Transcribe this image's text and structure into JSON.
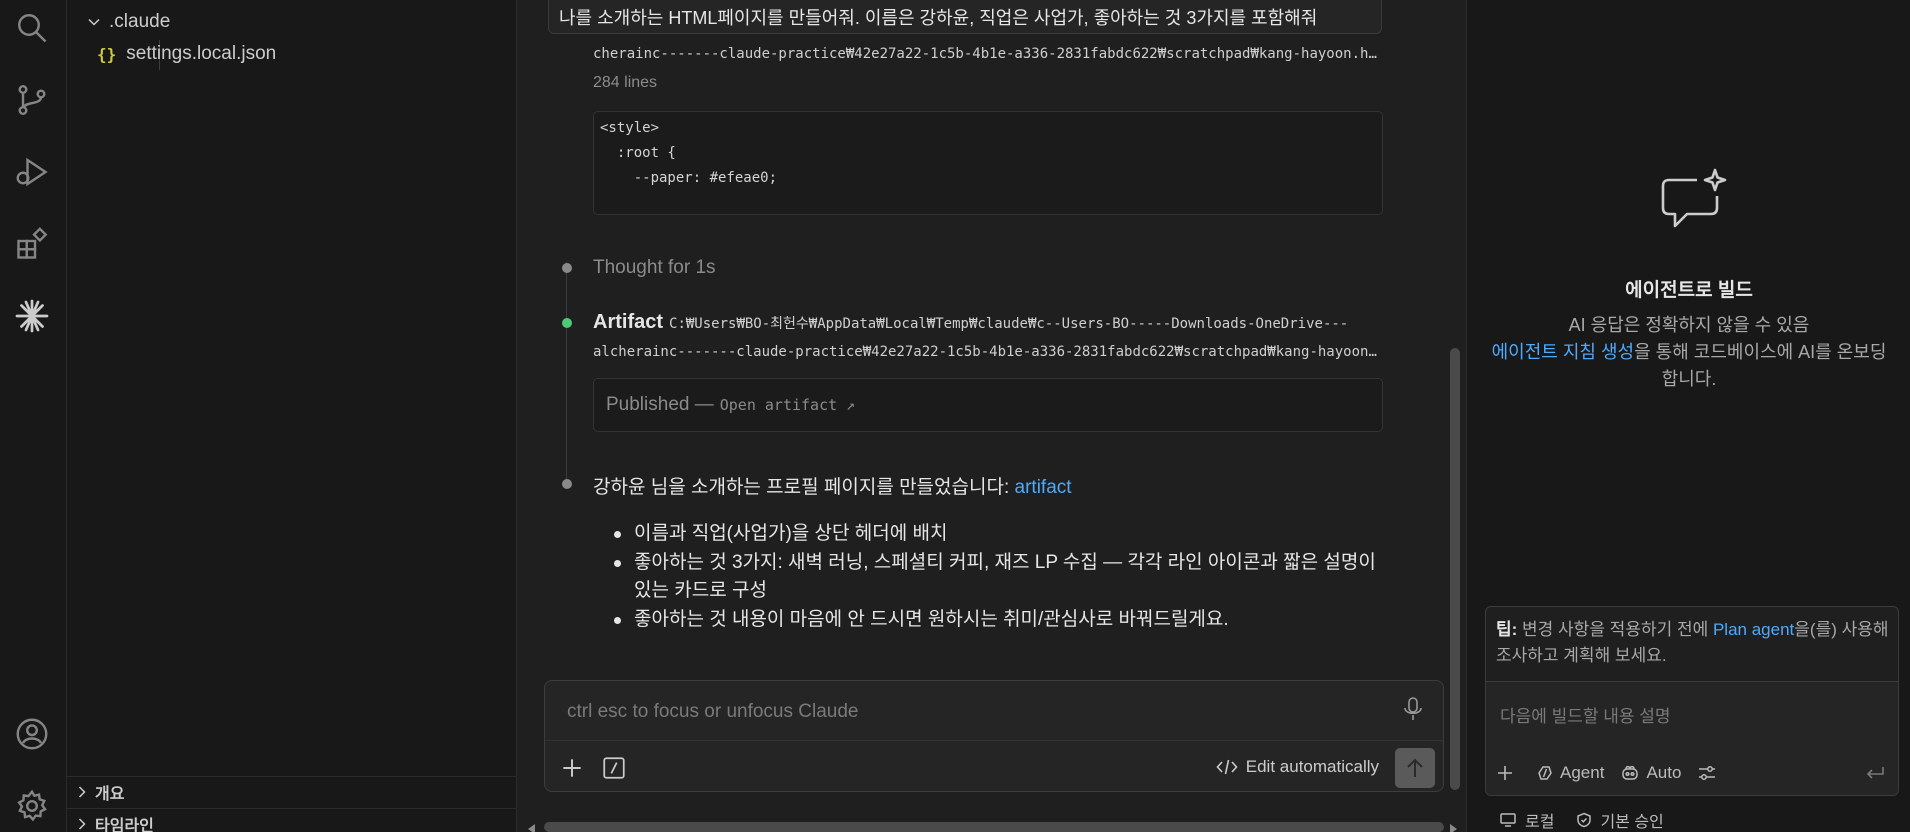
{
  "explorer": {
    "folder_name": ".claude",
    "file_icon": "{}",
    "file_name": "settings.local.json",
    "section_outline": "개요",
    "section_timeline": "타임라인"
  },
  "chat": {
    "user_message": "나를 소개하는 HTML페이지를 만들어줘. 이름은 강하윤, 직업은 사업가, 좋아하는 것 3가지를 포함해줘",
    "file_path": "cherainc-------claude-practice₩42e27a22-1c5b-4b1e-a336-2831fabdc622₩scratchpad₩kang-hayoon.html",
    "lines_count": "284 lines",
    "code_lines": [
      "<style>",
      "  :root {",
      "    --paper: #efeae0;"
    ],
    "thought": "Thought for 1s",
    "artifact_label": "Artifact",
    "artifact_path_1": "C:₩Users₩BO-최헌수₩AppData₩Local₩Temp₩claude₩c--Users-BO-----Downloads-OneDrive---",
    "artifact_path_2": "alcherainc-------claude-practice₩42e27a22-1c5b-4b1e-a336-2831fabdc622₩scratchpad₩kang-hayoon.html",
    "published": "Published —",
    "open_artifact": "Open artifact ↗",
    "reply_text": "강하윤 님을 소개하는 프로필 페이지를 만들었습니다: ",
    "reply_link": "artifact",
    "bullets": [
      "이름과 직업(사업가)을 상단 헤더에 배치",
      "좋아하는 것 3가지: 새벽 러닝, 스페셜티 커피, 재즈 LP 수집 — 각각 라인 아이콘과 짧은 설명이 있는 카드로 구성",
      "좋아하는 것 내용이 마음에 안 드시면 원하시는 취미/관심사로 바꿔드릴게요."
    ],
    "input_placeholder": "ctrl esc to focus or unfocus Claude",
    "edit_mode": "Edit automatically"
  },
  "agent_panel": {
    "title": "에이전트로 빌드",
    "desc_line1": "AI 응답은 정확하지 않을 수 있음",
    "desc_link": "에이전트 지침 생성",
    "desc_line2": "을 통해 코드베이스에 AI를 온보딩합니다.",
    "tip_label": "팁:",
    "tip_text1": " 변경 사항을 적용하기 전에 ",
    "tip_link": "Plan agent",
    "tip_text2": "을(를) 사용해 조사하고 계획해 보세요.",
    "input_placeholder": "다음에 빌드할 내용 설명",
    "agent_label": "Agent",
    "auto_label": "Auto",
    "local_label": "로컬",
    "approval_label": "기본 승인"
  },
  "colors": {
    "accent_link": "#4daafc",
    "success_dot": "#4ec97a",
    "json_icon": "#cbcb41"
  }
}
